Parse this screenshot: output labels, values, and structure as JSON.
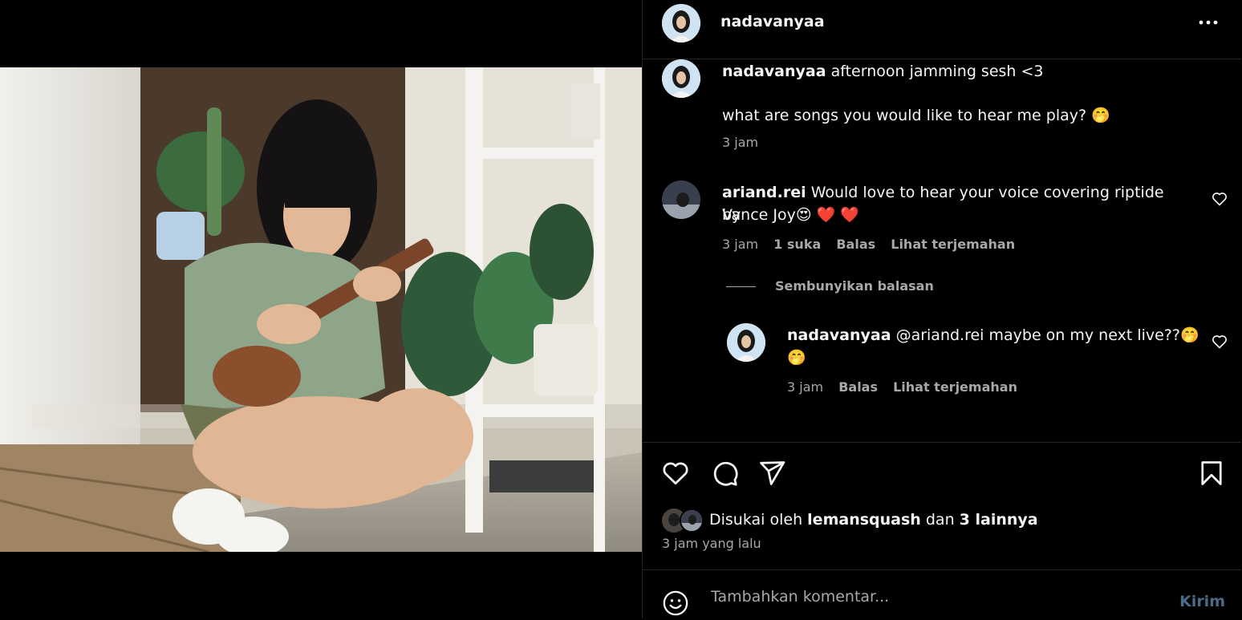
{
  "post": {
    "author": "nadavanyaa",
    "caption_user": "nadavanyaa",
    "caption_line1": "afternoon jamming sesh <3",
    "caption_line2": "what are songs you would like to hear me play? 🤭",
    "caption_time": "3 jam"
  },
  "comments": [
    {
      "user": "ariand.rei",
      "text_line1": "Would love to hear your voice covering riptide by",
      "text_line2": "Vance Joy😍 ❤️ ❤️",
      "time": "3 jam",
      "likes": "1 suka",
      "reply_label": "Balas",
      "translate_label": "Lihat terjemahan",
      "hide_replies_label": "Sembunyikan balasan",
      "replies": [
        {
          "user": "nadavanyaa",
          "text_line1": "@ariand.rei maybe on my next live??🤭",
          "text_line2": "🤭",
          "time": "3 jam",
          "reply_label": "Balas",
          "translate_label": "Lihat terjemahan"
        }
      ]
    }
  ],
  "likes_line": {
    "prefix": "Disukai oleh",
    "user": "lemansquash",
    "middle": "dan",
    "others": "3 lainnya"
  },
  "posted_time": "3 jam yang lalu",
  "add_comment": {
    "placeholder": "Tambahkan komentar...",
    "submit_label": "Kirim"
  },
  "icons": {
    "more": "more-horizontal-icon",
    "like": "heart-icon",
    "comment": "comment-icon",
    "share": "send-icon",
    "save": "bookmark-icon",
    "emoji": "emoji-icon"
  },
  "colors": {
    "background": "#000000",
    "text": "#f5f5f5",
    "secondary_text": "#a8a8a8",
    "divider": "#262626",
    "submit_disabled": "#4a6a86"
  }
}
